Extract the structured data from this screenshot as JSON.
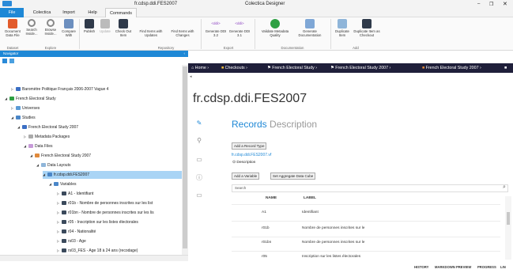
{
  "window": {
    "doc_title": "fr.cdsp.ddi.FES2007",
    "app_title": "Colectica Designer"
  },
  "menu": {
    "file": "File",
    "colectica": "Colectica",
    "import": "Import",
    "help": "Help",
    "commands": "Commands"
  },
  "ribbon": {
    "buttons": [
      "Document Data File",
      "Search Inside...",
      "Browse Inside...",
      "Compare With",
      "Publish",
      "Update",
      "Check Out Item",
      "Find Items with Updates",
      "Find Items with Changes",
      "Generate DDI 3.2",
      "Generate DDI 3.1",
      "Validate Metadata Quality",
      "Generate Documentation",
      "Duplicate Item",
      "Duplicate Item as Checkout"
    ],
    "groups": [
      "Dataset",
      "Explore",
      "Repository",
      "Export",
      "Documentation",
      "Add"
    ],
    "ddi_tag_1": "<ddi>",
    "ddi_tag_2": "<ddi>"
  },
  "navigator": {
    "title": "Navigator",
    "tree": [
      {
        "label": "Baromètre Politique Français 2006-2007 Vague 4"
      },
      {
        "label": "French Electoral Study"
      },
      {
        "label": "Universes"
      },
      {
        "label": "Studies"
      },
      {
        "label": "French Electoral Study 2007"
      },
      {
        "label": "Metadata Packages"
      },
      {
        "label": "Data Files"
      },
      {
        "label": "French Electoral Study 2007"
      },
      {
        "label": "Data Layouts"
      },
      {
        "label": "fr.cdsp.ddi.FES2007"
      },
      {
        "label": "Variables"
      },
      {
        "label": "A1 - Identifiant"
      },
      {
        "label": "r01b - Nombre de personnes inscrites sur les list"
      },
      {
        "label": "r01bn - Nombre de personnes inscrites sur les lis"
      },
      {
        "label": "r05 - Inscription sur les listes électorales"
      },
      {
        "label": "r04 - Nationalité"
      },
      {
        "label": "rs03 - Age"
      },
      {
        "label": "rs03_FES - Age 18 à 24 ans (recodage)"
      }
    ]
  },
  "breadcrumbs": [
    "Home",
    "Checkouts",
    "French Electoral Study",
    "French Electoral Study 2007",
    "French Electoral Study 2007"
  ],
  "main": {
    "title": "fr.cdsp.ddi.FES2007",
    "tab_records": "Records",
    "tab_description": "Description",
    "add_record_type": "Add a Record Type",
    "record_link": "fr.cdsp.ddi.FES2007.vf",
    "description_toggle": "Description",
    "add_variable": "Add a Variable",
    "set_aggregate": "Set Aggregate Data Cube",
    "search_placeholder": "Search",
    "columns": [
      "NAME",
      "LABEL"
    ],
    "rows": [
      {
        "name": "A1",
        "label": "Identifiant"
      },
      {
        "name": "r01b",
        "label": "Nombre de personnes inscrites sur le"
      },
      {
        "name": "r01bn",
        "label": "Nombre de personnes inscrites sur le"
      },
      {
        "name": "r05",
        "label": "Inscription sur les listes électorales"
      }
    ]
  },
  "status": [
    "HISTORY",
    "MARKDOWN PREVIEW",
    "PROGRESS",
    "LIN"
  ],
  "colors": {
    "accent": "#1e88d6",
    "breadcrumb_bg": "#1f1f3a",
    "selection": "#a9d4f5"
  }
}
